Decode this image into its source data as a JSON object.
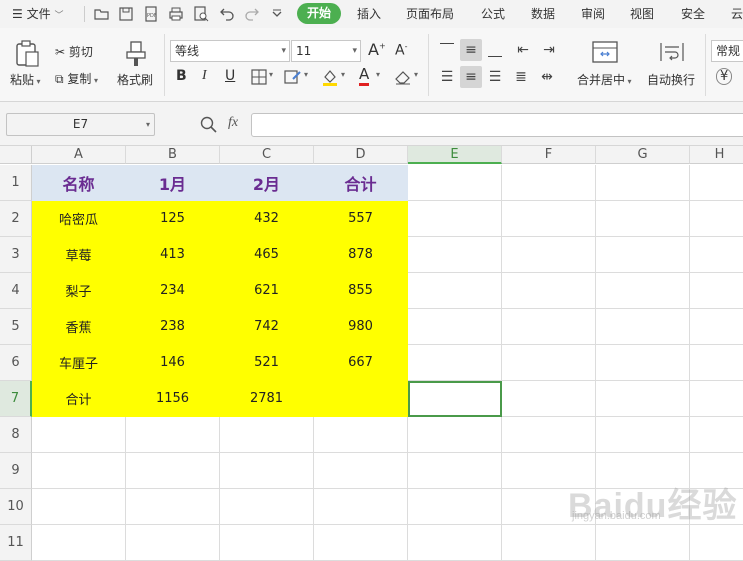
{
  "menu": {
    "file_label": "文件",
    "tabs": [
      "开始",
      "插入",
      "页面布局",
      "公式",
      "数据",
      "审阅",
      "视图",
      "安全",
      "云"
    ],
    "active_tab": "开始"
  },
  "ribbon": {
    "paste": "粘贴",
    "cut": "剪切",
    "copy": "复制",
    "format_painter": "格式刷",
    "font_name": "等线",
    "font_size": "11",
    "merge_center": "合并居中",
    "wrap_text": "自动换行",
    "number_format": "常规",
    "currency_symbol": "¥"
  },
  "formula_bar": {
    "cell_ref": "E7",
    "fx": "fx",
    "value": ""
  },
  "sheet": {
    "columns": [
      "A",
      "B",
      "C",
      "D",
      "E",
      "F",
      "G",
      "H"
    ],
    "rows": [
      "1",
      "2",
      "3",
      "4",
      "5",
      "6",
      "7",
      "8",
      "9",
      "10",
      "11"
    ],
    "selected_cell": "E7",
    "header_row": [
      "名称",
      "1月",
      "2月",
      "合计"
    ],
    "data_rows": [
      [
        "哈密瓜",
        "125",
        "432",
        "557"
      ],
      [
        "草莓",
        "413",
        "465",
        "878"
      ],
      [
        "梨子",
        "234",
        "621",
        "855"
      ],
      [
        "香蕉",
        "238",
        "742",
        "980"
      ],
      [
        "车厘子",
        "146",
        "521",
        "667"
      ],
      [
        "合计",
        "1156",
        "2781",
        ""
      ]
    ],
    "header_fill": "#dce6f2",
    "header_text_color": "#6a2c91",
    "data_fill": "#ffff00"
  },
  "watermark": {
    "logo_text": "Baidu经验",
    "url": "jingyan.baidu.com"
  }
}
